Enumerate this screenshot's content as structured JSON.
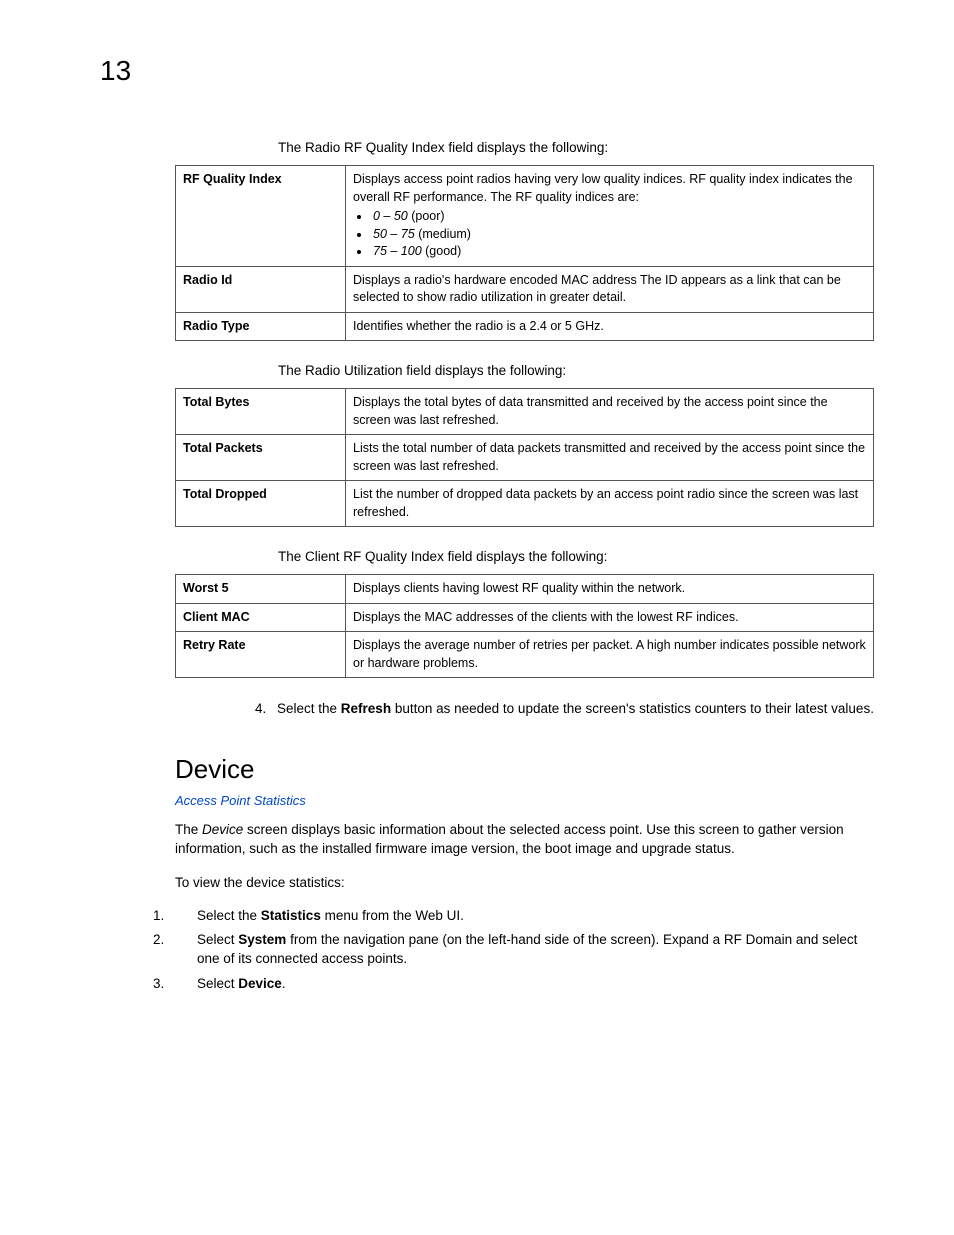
{
  "pageNumber": "13",
  "section1": {
    "intro": "The Radio RF Quality Index field displays the following:",
    "rows": [
      {
        "term": "RF Quality Index",
        "desc_pre": "Displays access point radios having very low quality indices. RF quality index indicates the overall RF performance. The RF quality indices are:",
        "bullets": [
          {
            "range": "0 – 50",
            "label": " (poor)"
          },
          {
            "range": "50 – 75",
            "label": " (medium)"
          },
          {
            "range": "75 – 100",
            "label": " (good)"
          }
        ]
      },
      {
        "term": "Radio Id",
        "desc": "Displays a radio's hardware encoded MAC address The ID appears as a link that can be selected to show radio utilization in greater detail."
      },
      {
        "term": "Radio Type",
        "desc": "Identifies whether the radio is a 2.4 or 5 GHz."
      }
    ]
  },
  "section2": {
    "intro": "The Radio Utilization field displays the following:",
    "rows": [
      {
        "term": "Total Bytes",
        "desc": "Displays the total bytes of data transmitted and received by the access point since the screen was last refreshed."
      },
      {
        "term": "Total Packets",
        "desc": "Lists the total number of data packets transmitted and received by the access point since the screen was last refreshed."
      },
      {
        "term": "Total Dropped",
        "desc": "List the number of dropped data packets by an access point radio since the screen was last refreshed."
      }
    ]
  },
  "section3": {
    "intro": "The Client RF Quality Index field displays the following:",
    "rows": [
      {
        "term": "Worst 5",
        "desc": "Displays clients having lowest RF quality within the network."
      },
      {
        "term": "Client MAC",
        "desc": "Displays the MAC addresses of the clients with the lowest RF indices."
      },
      {
        "term": "Retry Rate",
        "desc": "Displays the average number of retries per packet. A high number indicates possible network or hardware problems."
      }
    ]
  },
  "step4": {
    "num": "4.",
    "pre": "Select the ",
    "bold": "Refresh",
    "post": " button as needed to update the screen's statistics counters to their latest values."
  },
  "device": {
    "heading": "Device",
    "link": "Access Point Statistics",
    "para1_pre": "The ",
    "para1_ital": "Device",
    "para1_post": " screen displays basic information about the selected access point. Use this screen to gather version information, such as the installed firmware image version, the boot image and upgrade status.",
    "para2": "To view the device statistics:",
    "steps": [
      {
        "num": "1.",
        "pre": "Select the ",
        "bold": "Statistics",
        "post": " menu from the Web UI."
      },
      {
        "num": "2.",
        "pre": "Select ",
        "bold": "System",
        "post": " from the navigation pane (on the left-hand side of the screen). Expand a RF Domain and select one of its connected access points."
      },
      {
        "num": "3.",
        "pre": "Select ",
        "bold": "Device",
        "post": "."
      }
    ]
  }
}
